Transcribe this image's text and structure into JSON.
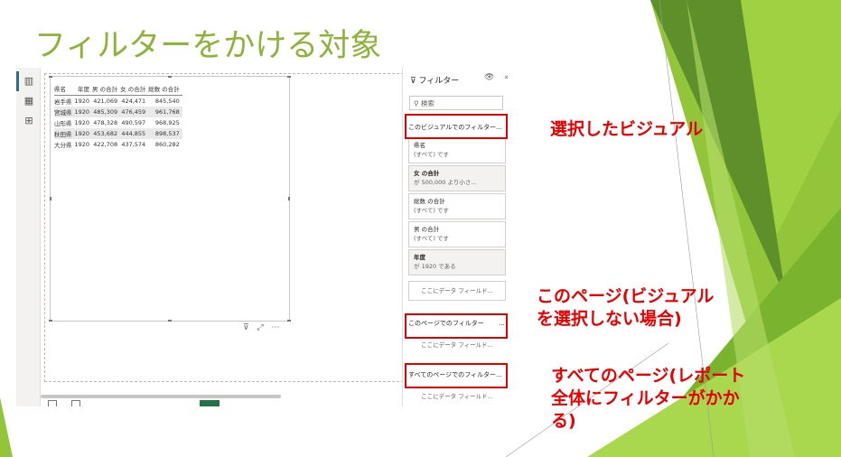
{
  "slide": {
    "title": "フィルターをかける対象",
    "colors": {
      "title": "#8db33a",
      "annotation": "#e80000",
      "highlight_box": "#e00000",
      "deco_green": "#93c53a",
      "deco_dark": "#5f8f2a"
    }
  },
  "left_toolbar": {
    "items": [
      {
        "name": "report-view-icon",
        "glyph": "▥"
      },
      {
        "name": "data-view-icon",
        "glyph": "▦"
      },
      {
        "name": "model-view-icon",
        "glyph": "⊞"
      }
    ]
  },
  "table_visual": {
    "headers": [
      "県名",
      "年度",
      "男 の合計",
      "女 の合計",
      "総数 の合計"
    ],
    "rows": [
      [
        "岩手県",
        "1920",
        "421,069",
        "424,471",
        "845,540"
      ],
      [
        "宮城県",
        "1920",
        "485,309",
        "476,459",
        "961,768"
      ],
      [
        "山形県",
        "1920",
        "478,328",
        "490,597",
        "968,925"
      ],
      [
        "秋田県",
        "1920",
        "453,682",
        "444,855",
        "898,537"
      ],
      [
        "大分県",
        "1920",
        "422,708",
        "437,574",
        "860,282"
      ]
    ],
    "tools": "⊽ ⤢ ⋯"
  },
  "filter_pane": {
    "title": "フィルター",
    "icon_glyphs": "👁 »",
    "search_placeholder": "検索",
    "visual_section": "このビジュアルでのフィルター...",
    "filters": [
      {
        "field": "県名",
        "state": "(すべて) です",
        "applied": false
      },
      {
        "field": "女 の合計",
        "state": "が 500,000 より小さ...",
        "applied": true
      },
      {
        "field": "総数 の合計",
        "state": "(すべて) です",
        "applied": false
      },
      {
        "field": "男 の合計",
        "state": "(すべて) です",
        "applied": false
      },
      {
        "field": "年度",
        "state": "が 1920 である",
        "applied": true
      }
    ],
    "add_field": "ここにデータ フィールド...",
    "page_section": "このページでのフィルター",
    "page_section_more": "...",
    "page_add_field": "ここにデータ フィールド...",
    "all_pages_section": "すべてのページでのフィルター...",
    "all_add_field": "ここにデータ フィールド..."
  },
  "annotations": {
    "visual": "選択したビジュアル",
    "page": [
      "このページ(ビジュアル",
      "を選択しない場合)"
    ],
    "all_pages": [
      "すべてのページ(レポート",
      "全体にフィルターがかか",
      "る)"
    ]
  }
}
